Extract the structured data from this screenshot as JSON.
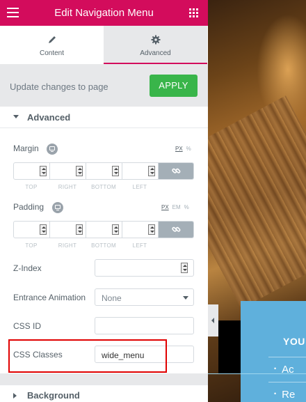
{
  "header": {
    "title": "Edit Navigation Menu",
    "menu_icon": "hamburger-icon",
    "apps_icon": "grid-icon"
  },
  "tabs": [
    {
      "label": "Content",
      "icon": "pencil-icon"
    },
    {
      "label": "Advanced",
      "icon": "gear-icon"
    }
  ],
  "update_bar": {
    "text": "Update changes to page",
    "apply_label": "APPLY"
  },
  "sections": {
    "advanced": "Advanced",
    "background": "Background"
  },
  "margin": {
    "label": "Margin",
    "units": [
      "PX",
      "%"
    ],
    "active_unit": "PX",
    "sides": [
      "TOP",
      "RIGHT",
      "BOTTOM",
      "LEFT"
    ]
  },
  "padding": {
    "label": "Padding",
    "units": [
      "PX",
      "EM",
      "%"
    ],
    "active_unit": "PX",
    "sides": [
      "TOP",
      "RIGHT",
      "BOTTOM",
      "LEFT"
    ]
  },
  "z_index": {
    "label": "Z-Index",
    "value": ""
  },
  "entrance_animation": {
    "label": "Entrance Animation",
    "value": "None"
  },
  "css_id": {
    "label": "CSS ID",
    "value": ""
  },
  "css_classes": {
    "label": "CSS Classes",
    "value": "wide_menu"
  },
  "preview": {
    "heading": "YOU",
    "items": [
      "Ac",
      "Re"
    ]
  },
  "colors": {
    "header": "#d30c5c",
    "apply": "#39b54a",
    "preview_box": "#5fb0dc",
    "highlight": "#e00000"
  }
}
